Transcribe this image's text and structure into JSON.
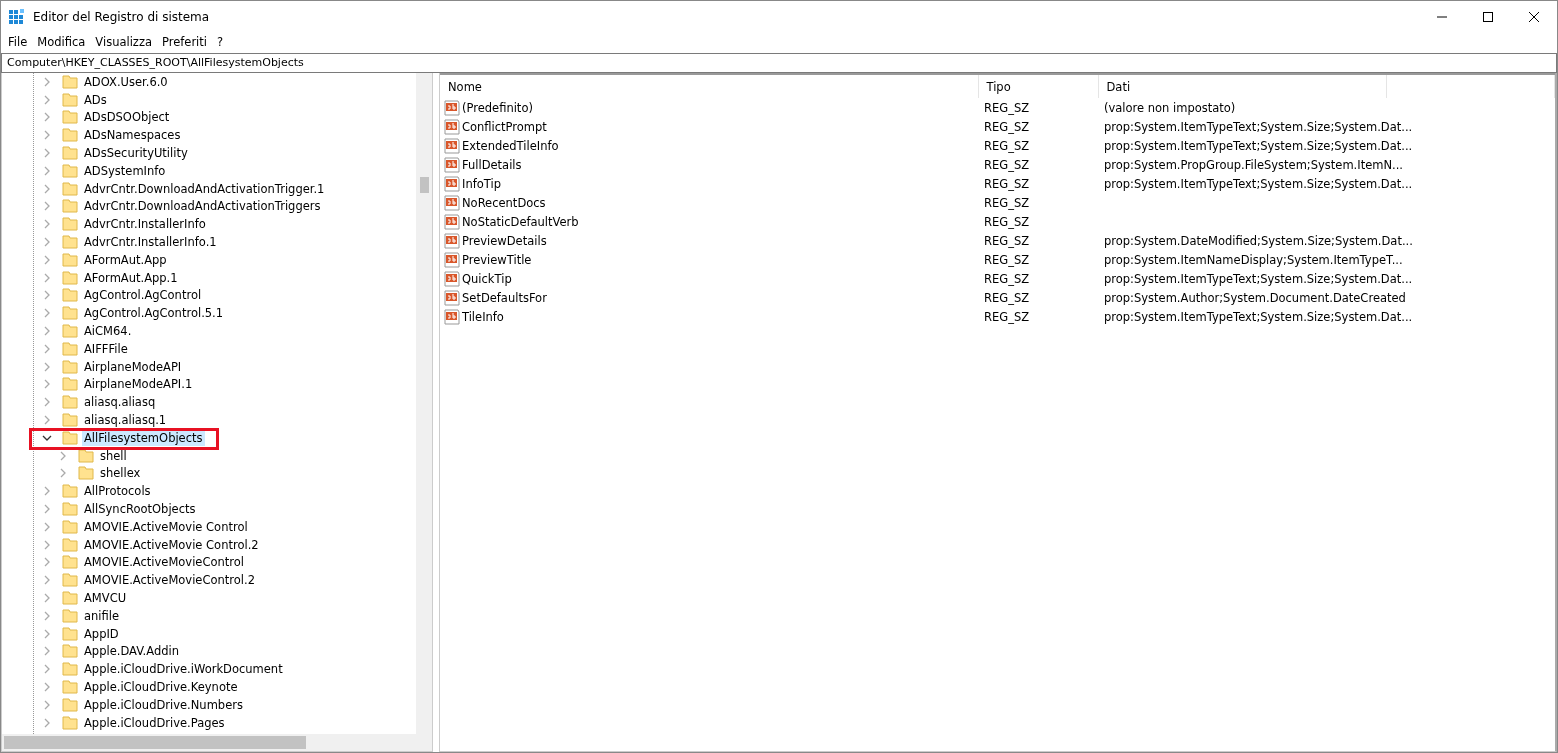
{
  "window": {
    "title": "Editor del Registro di sistema"
  },
  "menu": [
    "File",
    "Modifica",
    "Visualizza",
    "Preferiti",
    "?"
  ],
  "address": "Computer\\HKEY_CLASSES_ROOT\\AllFilesystemObjects",
  "tree": [
    {
      "label": "ADOX.User.6.0",
      "expanded": false,
      "selected": false
    },
    {
      "label": "ADs",
      "expanded": false,
      "selected": false
    },
    {
      "label": "ADsDSOObject",
      "expanded": false,
      "selected": false
    },
    {
      "label": "ADsNamespaces",
      "expanded": false,
      "selected": false
    },
    {
      "label": "ADsSecurityUtility",
      "expanded": false,
      "selected": false
    },
    {
      "label": "ADSystemInfo",
      "expanded": false,
      "selected": false
    },
    {
      "label": "AdvrCntr.DownloadAndActivationTrigger.1",
      "expanded": false,
      "selected": false
    },
    {
      "label": "AdvrCntr.DownloadAndActivationTriggers",
      "expanded": false,
      "selected": false
    },
    {
      "label": "AdvrCntr.InstallerInfo",
      "expanded": false,
      "selected": false
    },
    {
      "label": "AdvrCntr.InstallerInfo.1",
      "expanded": false,
      "selected": false
    },
    {
      "label": "AFormAut.App",
      "expanded": false,
      "selected": false
    },
    {
      "label": "AFormAut.App.1",
      "expanded": false,
      "selected": false
    },
    {
      "label": "AgControl.AgControl",
      "expanded": false,
      "selected": false
    },
    {
      "label": "AgControl.AgControl.5.1",
      "expanded": false,
      "selected": false
    },
    {
      "label": "AiCM64.",
      "expanded": false,
      "selected": false
    },
    {
      "label": "AIFFFile",
      "expanded": false,
      "selected": false
    },
    {
      "label": "AirplaneModeAPI",
      "expanded": false,
      "selected": false
    },
    {
      "label": "AirplaneModeAPI.1",
      "expanded": false,
      "selected": false
    },
    {
      "label": "aliasq.aliasq",
      "expanded": false,
      "selected": false
    },
    {
      "label": "aliasq.aliasq.1",
      "expanded": false,
      "selected": false
    },
    {
      "label": "AllFilesystemObjects",
      "expanded": true,
      "selected": true,
      "children": [
        {
          "label": "shell",
          "expanded": false,
          "selected": false
        },
        {
          "label": "shellex",
          "expanded": false,
          "selected": false
        }
      ]
    },
    {
      "label": "AllProtocols",
      "expanded": false,
      "selected": false
    },
    {
      "label": "AllSyncRootObjects",
      "expanded": false,
      "selected": false
    },
    {
      "label": "AMOVIE.ActiveMovie Control",
      "expanded": false,
      "selected": false
    },
    {
      "label": "AMOVIE.ActiveMovie Control.2",
      "expanded": false,
      "selected": false
    },
    {
      "label": "AMOVIE.ActiveMovieControl",
      "expanded": false,
      "selected": false
    },
    {
      "label": "AMOVIE.ActiveMovieControl.2",
      "expanded": false,
      "selected": false
    },
    {
      "label": "AMVCU",
      "expanded": false,
      "selected": false
    },
    {
      "label": "anifile",
      "expanded": false,
      "selected": false
    },
    {
      "label": "AppID",
      "expanded": false,
      "selected": false
    },
    {
      "label": "Apple.DAV.Addin",
      "expanded": false,
      "selected": false
    },
    {
      "label": "Apple.iCloudDrive.iWorkDocument",
      "expanded": false,
      "selected": false
    },
    {
      "label": "Apple.iCloudDrive.Keynote",
      "expanded": false,
      "selected": false
    },
    {
      "label": "Apple.iCloudDrive.Numbers",
      "expanded": false,
      "selected": false
    },
    {
      "label": "Apple.iCloudDrive.Pages",
      "expanded": false,
      "selected": false
    }
  ],
  "table": {
    "columns": [
      "Nome",
      "Tipo",
      "Dati"
    ],
    "rows": [
      [
        "(Predefinito)",
        "REG_SZ",
        "(valore non impostato)"
      ],
      [
        "ConflictPrompt",
        "REG_SZ",
        "prop:System.ItemTypeText;System.Size;System.Dat..."
      ],
      [
        "ExtendedTileInfo",
        "REG_SZ",
        "prop:System.ItemTypeText;System.Size;System.Dat..."
      ],
      [
        "FullDetails",
        "REG_SZ",
        "prop:System.PropGroup.FileSystem;System.ItemN..."
      ],
      [
        "InfoTip",
        "REG_SZ",
        "prop:System.ItemTypeText;System.Size;System.Dat..."
      ],
      [
        "NoRecentDocs",
        "REG_SZ",
        ""
      ],
      [
        "NoStaticDefaultVerb",
        "REG_SZ",
        ""
      ],
      [
        "PreviewDetails",
        "REG_SZ",
        "prop:System.DateModified;System.Size;System.Dat..."
      ],
      [
        "PreviewTitle",
        "REG_SZ",
        "prop:System.ItemNameDisplay;System.ItemTypeT..."
      ],
      [
        "QuickTip",
        "REG_SZ",
        "prop:System.ItemTypeText;System.Size;System.Dat..."
      ],
      [
        "SetDefaultsFor",
        "REG_SZ",
        "prop:System.Author;System.Document.DateCreated"
      ],
      [
        "TileInfo",
        "REG_SZ",
        "prop:System.ItemTypeText;System.Size;System.Dat..."
      ]
    ]
  }
}
